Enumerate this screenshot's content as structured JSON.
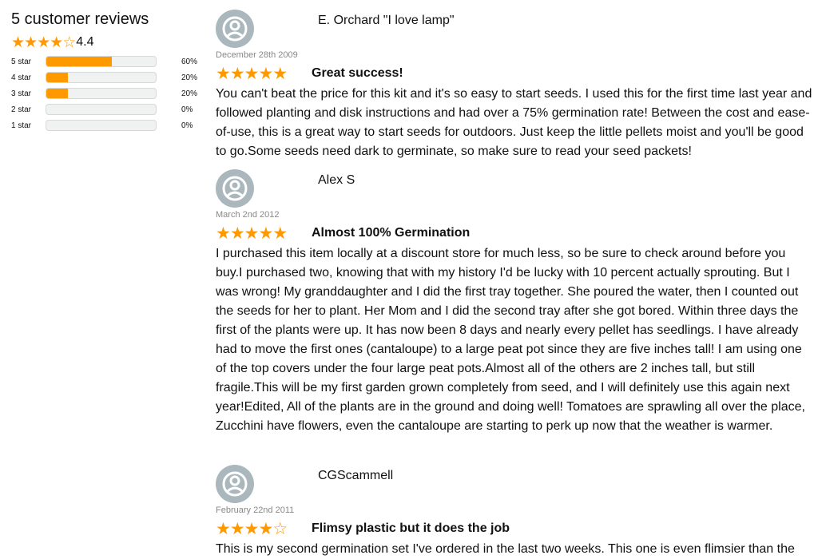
{
  "summary": {
    "title": "5 customer reviews",
    "average": "4.4",
    "overall_stars": 4,
    "histogram": [
      {
        "label": "5 star",
        "percent": "60%",
        "fraction": 0.6
      },
      {
        "label": "4 star",
        "percent": "20%",
        "fraction": 0.2
      },
      {
        "label": "3 star",
        "percent": "20%",
        "fraction": 0.2
      },
      {
        "label": "2 star",
        "percent": "0%",
        "fraction": 0
      },
      {
        "label": "1 star",
        "percent": "0%",
        "fraction": 0
      }
    ]
  },
  "colors": {
    "star": "#ff9900",
    "bar_bg": "#f0f2f2",
    "avatar": "#aab8bd"
  },
  "reviews": [
    {
      "reviewer": "E. Orchard \"I love lamp\"",
      "date": "December 28th 2009",
      "stars": 5,
      "title": "Great success!",
      "body": "You can't beat the price for this kit and it's so easy to start seeds. I used this for the first time last year and followed planting and disk instructions and had over a 75% germination rate! Between the cost and ease-of-use, this is a great way to start seeds for outdoors. Just keep the little pellets moist and you'll be good to go.Some seeds need dark to germinate, so make sure to read your seed packets!"
    },
    {
      "reviewer": "Alex S",
      "date": "March 2nd 2012",
      "stars": 5,
      "title": "Almost 100% Germination",
      "body": "I purchased this item locally at a discount store for much less, so be sure to check around before you buy.I purchased two, knowing that with my history I'd be lucky with 10 percent actually sprouting. But I was wrong! My granddaughter and I did the first tray together. She poured the water, then I counted out the seeds for her to plant. Her Mom and I did the second tray after she got bored. Within three days the first of the plants were up. It has now been 8 days and nearly every pellet has seedlings. I have already had to move the first ones (cantaloupe) to a large peat pot since they are five inches tall! I am using one of the top covers under the four large peat pots.Almost all of the others are 2 inches tall, but still fragile.This will be my first garden grown completely from seed, and I will definitely use this again next year!Edited, All of the plants are in the ground and doing well! Tomatoes are sprawling all over the place, Zucchini have flowers, even the cantaloupe are starting to perk up now that the weather is warmer."
    },
    {
      "reviewer": "CGScammell",
      "date": "February 22nd 2011",
      "stars": 4,
      "title": "Flimsy plastic but it does the job",
      "body": "This is my second germination set I've ordered in the last two weeks. This one is even flimsier than the"
    }
  ]
}
